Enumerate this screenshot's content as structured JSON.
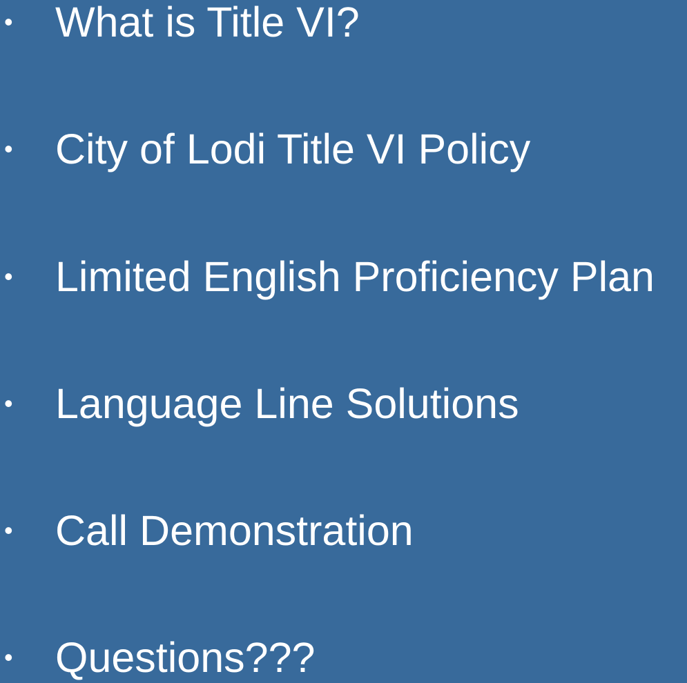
{
  "slide": {
    "background_color": "#386a9b",
    "text_color": "#ffffff",
    "bullet_glyph": "•",
    "items": [
      {
        "label": "What is Title VI?"
      },
      {
        "label": "City of Lodi Title VI Policy"
      },
      {
        "label": "Limited English Proficiency Plan"
      },
      {
        "label": "Language Line Solutions"
      },
      {
        "label": "Call Demonstration"
      },
      {
        "label": "Questions???"
      }
    ]
  }
}
